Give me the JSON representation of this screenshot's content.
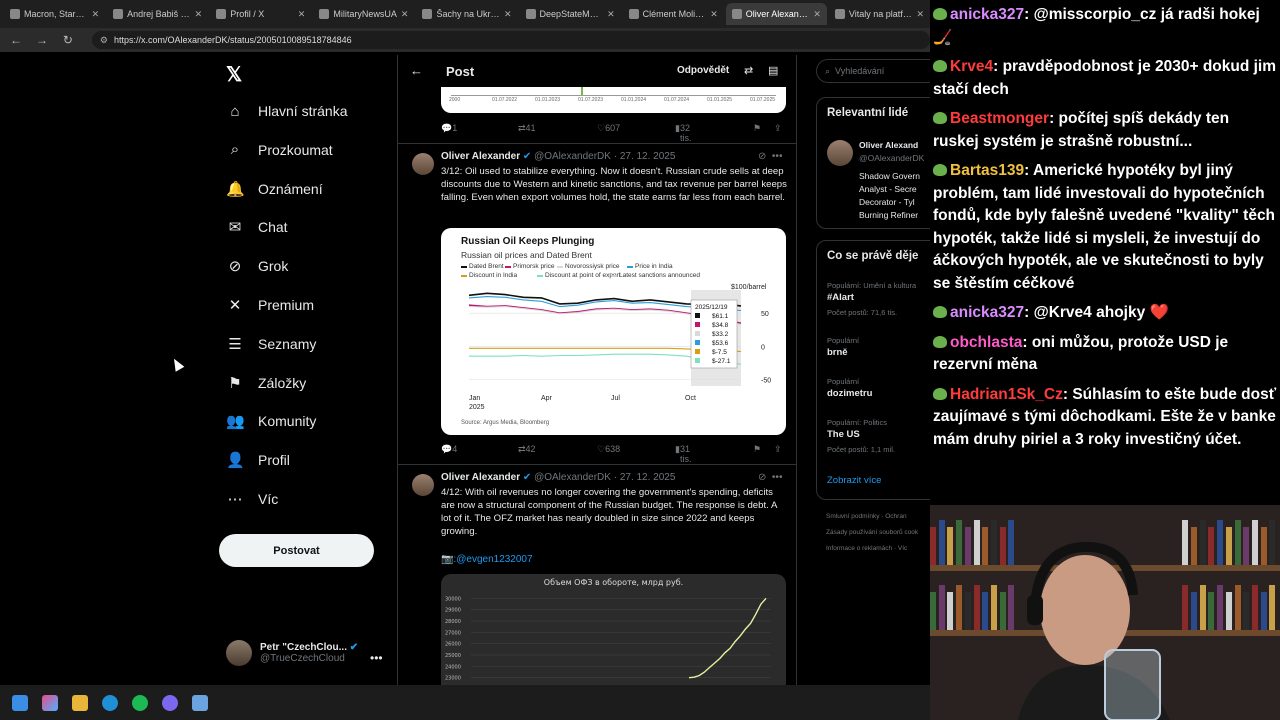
{
  "browser": {
    "tabs": [
      {
        "title": "Macron, Starmer a",
        "active": false
      },
      {
        "title": "Andrej Babiš na pl",
        "active": false
      },
      {
        "title": "Profil / X",
        "active": false
      },
      {
        "title": "MilitaryNewsUA",
        "active": false
      },
      {
        "title": "Šachy na Ukrajině",
        "active": false
      },
      {
        "title": "DeepStateMAP | J",
        "active": false
      },
      {
        "title": "Clément Molin na",
        "active": false
      },
      {
        "title": "Oliver Alexander n",
        "active": true
      },
      {
        "title": "Vitaly na platform",
        "active": false
      }
    ],
    "url": "https://x.com/OAlexanderDK/status/2005010089518784846"
  },
  "nav": {
    "items": [
      {
        "label": "Hlavní stránka",
        "icon": "home-icon",
        "glyph": "⌂"
      },
      {
        "label": "Prozkoumat",
        "icon": "search-icon",
        "glyph": "⌕"
      },
      {
        "label": "Oznámení",
        "icon": "bell-icon",
        "glyph": "🔔"
      },
      {
        "label": "Chat",
        "icon": "mail-icon",
        "glyph": "✉"
      },
      {
        "label": "Grok",
        "icon": "grok-icon",
        "glyph": "⊘"
      },
      {
        "label": "Premium",
        "icon": "x-icon",
        "glyph": "✕"
      },
      {
        "label": "Seznamy",
        "icon": "list-icon",
        "glyph": "☰"
      },
      {
        "label": "Záložky",
        "icon": "bookmark-icon",
        "glyph": "⚑"
      },
      {
        "label": "Komunity",
        "icon": "people-icon",
        "glyph": "👥"
      },
      {
        "label": "Profil",
        "icon": "person-icon",
        "glyph": "👤"
      },
      {
        "label": "Víc",
        "icon": "more-icon",
        "glyph": "⋯"
      }
    ],
    "post_label": "Postovat",
    "profile_name": "Petr \"CzechClou...",
    "profile_handle": "@TrueCzechCloud"
  },
  "main": {
    "title": "Post",
    "reply_label": "Odpovědět",
    "top_actions": {
      "replies": "1",
      "reposts": "41",
      "likes": "607",
      "views": "32 tis."
    },
    "prev_chart_ticks": [
      "2000",
      "01.07.2022",
      "01.01.2023",
      "01.07.2023",
      "01.01.2024",
      "01.07.2024",
      "01.01.2025",
      "01.07.2025"
    ],
    "tweets": [
      {
        "name": "Oliver Alexander",
        "handle_date": "@OAlexanderDK · 27. 12. 2025",
        "text": "3/12: Oil used to stabilize everything. Now it doesn't. Russian crude sells at deep discounts due to Western and kinetic sanctions, and tax revenue per barrel keeps falling. Even when export volumes hold, the state earns far less from each barrel.",
        "replies": "4",
        "reposts": "42",
        "likes": "638",
        "views": "31 tis."
      },
      {
        "name": "Oliver Alexander",
        "handle_date": "@OAlexanderDK · 27. 12. 2025",
        "text": "4/12: With oil revenues no longer covering the government's spending, deficits are now a structural component of the Russian budget. The response is debt. A lot of it. The OFZ market has nearly doubled in size since 2022 and keeps growing.",
        "link": "📷:@evgen1232007"
      }
    ]
  },
  "chart_data": [
    {
      "type": "line",
      "title": "Russian Oil Keeps Plunging",
      "subtitle": "Russian oil prices and Dated Brent",
      "legend": [
        "Dated Brent",
        "Primorsk price",
        "Novorossiysk price",
        "Price in India",
        "Discount in India",
        "Discount at point of export",
        "Latest sanctions announced"
      ],
      "colors": [
        "#111111",
        "#c0166e",
        "#d9d9d9",
        "#2a9fd6",
        "#d4a017",
        "#7fe0c0",
        "#cfcfcf"
      ],
      "x_ticks": [
        "Jan\n2025",
        "Apr",
        "Jul",
        "Oct"
      ],
      "y_ticks": [
        50,
        0,
        -50
      ],
      "y_unit": "$100/barrel",
      "tooltip_date": "2025/12/19",
      "tooltip_values": [
        "$61.1",
        "$34.8",
        "$33.2",
        "$53.6",
        "$-7.5",
        "$-27.1"
      ],
      "series": [
        {
          "name": "Dated Brent",
          "values": [
            77,
            80,
            78,
            74,
            73,
            64,
            65,
            70,
            72,
            68,
            70,
            67,
            64,
            63,
            64,
            61
          ]
        },
        {
          "name": "Primorsk price",
          "values": [
            62,
            60,
            61,
            58,
            55,
            50,
            52,
            56,
            57,
            55,
            56,
            54,
            50,
            46,
            40,
            35
          ]
        },
        {
          "name": "Novorossiysk price",
          "values": [
            60,
            59,
            60,
            57,
            54,
            49,
            51,
            55,
            56,
            54,
            55,
            53,
            49,
            45,
            39,
            33
          ]
        },
        {
          "name": "Price in India",
          "values": [
            73,
            75,
            74,
            70,
            68,
            60,
            62,
            67,
            69,
            65,
            66,
            63,
            60,
            58,
            56,
            54
          ]
        },
        {
          "name": "Discount in India",
          "values": [
            -3,
            -3,
            -3,
            -3,
            -3,
            -3,
            -3,
            -3,
            -3,
            -3,
            -3,
            -3,
            -4,
            -5,
            -6,
            -8
          ]
        },
        {
          "name": "Discount at point of export",
          "values": [
            -15,
            -15,
            -15,
            -14,
            -15,
            -14,
            -14,
            -13,
            -12,
            -12,
            -12,
            -13,
            -15,
            -20,
            -24,
            -27
          ]
        }
      ],
      "ylim": [
        -60,
        85
      ],
      "source": "Source: Argus Media, Bloomberg"
    },
    {
      "type": "line",
      "title": "Объем ОФЗ в обороте, млрд руб.",
      "y_ticks": [
        30000,
        29000,
        28000,
        27000,
        26000,
        25000,
        24000,
        23000
      ],
      "series": [
        {
          "name": "",
          "values": [
            23000,
            23050,
            23200,
            23500,
            23900,
            24300,
            24700,
            25200,
            25600,
            26200,
            26700,
            27300,
            27800,
            28600,
            29500,
            30000
          ]
        }
      ],
      "ylim": [
        22800,
        30300
      ]
    }
  ],
  "right": {
    "search_placeholder": "Vyhledávání",
    "relevant_title": "Relevantní lidé",
    "relevant_name": "Oliver Alexand",
    "relevant_handle": "@OAlexanderDK",
    "relevant_bio": [
      "Shadow Govern",
      "Analyst - Secre",
      "Decorator - Tyl",
      "Burning Refiner"
    ],
    "trending_title": "Co se právě děje",
    "trends": [
      {
        "meta": "Populární: Umění a kultura",
        "name": "#Alart",
        "count": "Počet postů: 71,6 tis."
      },
      {
        "meta": "Populární",
        "name": "brně",
        "count": ""
      },
      {
        "meta": "Populární",
        "name": "dozimetru",
        "count": ""
      },
      {
        "meta": "Populární: Politics",
        "name": "The US",
        "count": "Počet postů: 1,1 mil."
      }
    ],
    "show_more": "Zobrazit více",
    "footer": [
      "Smluvní podmínky · Ochran",
      "Zásady používání souborů cook",
      "Informace o reklamách · Víc"
    ]
  },
  "chat": {
    "messages": [
      {
        "user": "anicka327",
        "color": "#d88cff",
        "text": "@misscorpio_cz já radši hokej 🏒"
      },
      {
        "user": "Krve4",
        "color": "#ff3b3b",
        "text": "pravděpodobnost je 2030+ dokud jim stačí dech"
      },
      {
        "user": "Beastmonger",
        "color": "#ff3b3b",
        "text": "počítej spíš dekády ten ruskej systém je strašně robustní..."
      },
      {
        "user": "Bartas139",
        "color": "#f0c040",
        "text": "Americké hypotéky byl jiný problém, tam lidé investovali do hypotečních fondů, kde byly falešně uvedené \"kvality\" těch hypoték, takže lidé si mysleli, že investují do áčkových hypoték, ale ve skutečnosti to byly se štěstím céčkové"
      },
      {
        "user": "anicka327",
        "color": "#d88cff",
        "text": "@Krve4 ahojky ❤️"
      },
      {
        "user": "obchlasta",
        "color": "#ff5ac8",
        "text": "oni můžou, protože USD je rezervní měna"
      },
      {
        "user": "Hadrian1Sk_Cz",
        "color": "#ff3b3b",
        "text": "Súhlasím to ešte bude dosť zaujímavé s tými dôchodkami. Ešte že v banke mám druhy piriel a 3 roky investičný účet."
      }
    ]
  }
}
